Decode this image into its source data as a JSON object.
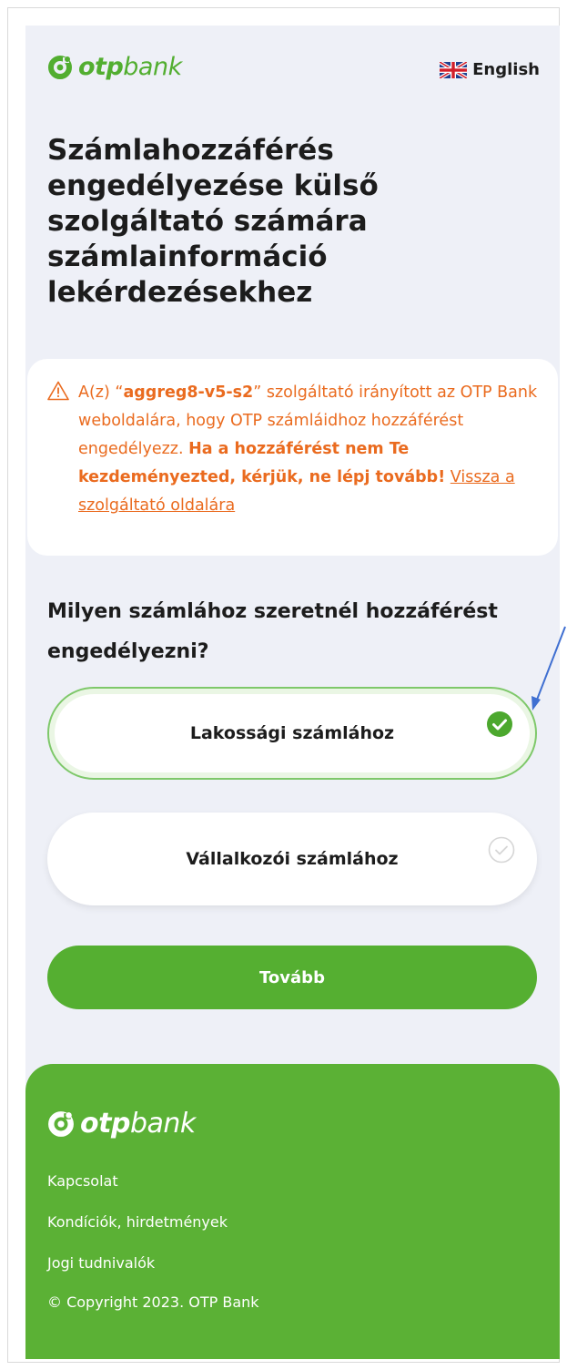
{
  "brand": {
    "logo_strong": "otp",
    "logo_light": "bank",
    "brand_color": "#52ae30",
    "warning_color": "#ea6b1f"
  },
  "header": {
    "language_label": "English",
    "language_icon": "uk-flag-icon"
  },
  "page": {
    "title": "Számlahozzáférés engedélyezése külső szolgáltató számára számlainformáció lekérdezésekhez"
  },
  "warning": {
    "prefix": "A(z) “",
    "provider": "aggreg8-v5-s2",
    "middle": "” szolgáltató irányított az OTP Bank weboldalára, hogy OTP számláidhoz hozzáférést engedélyezz.",
    "bold_notice": "Ha a hozzáférést nem Te kezdeményezted, kérjük, ne lépj tovább!",
    "back_link": "Vissza a szolgáltató oldalára"
  },
  "question": {
    "text": "Milyen számlához szeretnél hozzáférést engedélyezni?"
  },
  "options": [
    {
      "label": "Lakossági számlához",
      "selected": true
    },
    {
      "label": "Vállalkozói számlához",
      "selected": false
    }
  ],
  "cta": {
    "label": "Tovább"
  },
  "footer": {
    "links": [
      "Kapcsolat",
      "Kondíciók, hirdetmények",
      "Jogi tudnivalók"
    ],
    "copyright": "© Copyright 2023. OTP Bank"
  }
}
